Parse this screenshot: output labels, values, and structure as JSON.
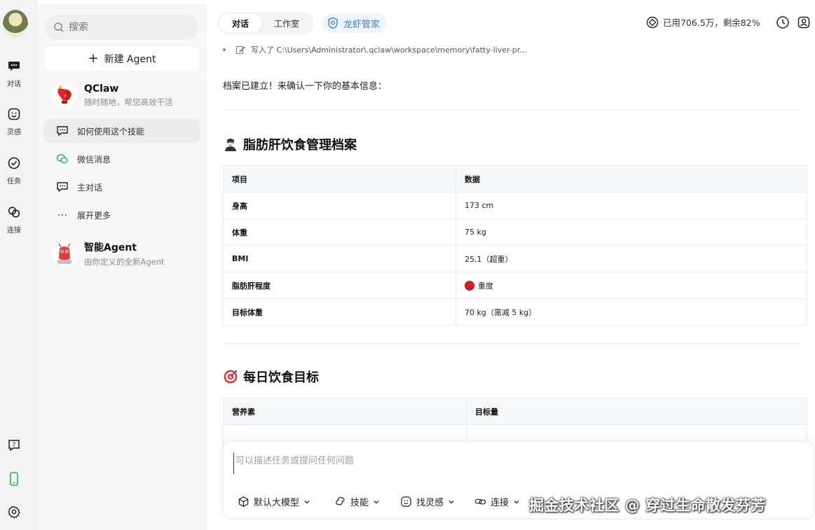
{
  "rail": {
    "items": [
      {
        "label": "对话",
        "icon": "chat-icon"
      },
      {
        "label": "灵感",
        "icon": "inspiration-icon"
      },
      {
        "label": "任务",
        "icon": "task-icon"
      },
      {
        "label": "连接",
        "icon": "link-icon"
      }
    ],
    "bottom_icons": [
      "help-icon",
      "phone-icon",
      "gear-icon"
    ]
  },
  "sidebar": {
    "search_placeholder": "搜索",
    "new_agent_label": "新建 Agent",
    "agents": [
      {
        "name": "QClaw",
        "subtitle": "随时随地，帮您高效干活"
      },
      {
        "name": "智能Agent",
        "subtitle": "由你定义的全新Agent"
      }
    ],
    "items": [
      {
        "label": "如何使用这个技能",
        "icon": "chat-bubble-icon",
        "active": true
      },
      {
        "label": "微信消息",
        "icon": "wechat-icon",
        "active": false
      },
      {
        "label": "主对话",
        "icon": "chat-bubble-icon",
        "active": false
      },
      {
        "label": "展开更多",
        "icon": "more-icon",
        "active": false
      }
    ]
  },
  "topbar": {
    "tabs": [
      "对话",
      "工作室"
    ],
    "brand_tab": "龙虾管家",
    "usage": "已用706.5万，剩余82%"
  },
  "chat": {
    "write_line": "写入了 C:\\Users\\Administrator\\.qclaw\\workspace\\memory\\fatty-liver-pr...",
    "message": "档案已建立！来确认一下你的基本信息：",
    "section1": {
      "title": "脂肪肝饮食管理档案",
      "headers": [
        "项目",
        "数据"
      ],
      "rows": [
        [
          "身高",
          "173 cm"
        ],
        [
          "体重",
          "75 kg"
        ],
        [
          "BMI",
          "25.1（超重）"
        ],
        [
          "脂肪肝程度",
          "重度"
        ],
        [
          "目标体重",
          "70 kg（需减 5 kg）"
        ]
      ]
    },
    "section2": {
      "title": "每日饮食目标",
      "headers": [
        "营养素",
        "目标量"
      ]
    }
  },
  "composer": {
    "placeholder": "可以描述任务或提问任何问题",
    "tools": [
      "默认大模型",
      "技能",
      "找灵感",
      "连接"
    ]
  },
  "watermark": "掘金技术社区 @ 穿过生命散发芬芳",
  "colors": {
    "accent": "#3d7be0",
    "severity_red": "#d4202c",
    "wechat_green": "#2bae45"
  }
}
